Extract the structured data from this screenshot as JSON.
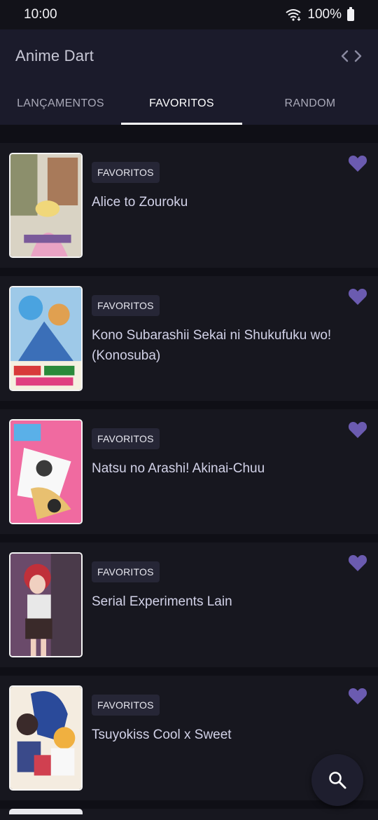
{
  "status": {
    "time": "10:00",
    "battery": "100%"
  },
  "app": {
    "title": "Anime Dart",
    "icon": "code-icon"
  },
  "tabs": [
    {
      "label": "LANÇAMENTOS",
      "active": false
    },
    {
      "label": "FAVORITOS",
      "active": true
    },
    {
      "label": "RANDOM",
      "active": false
    }
  ],
  "items": [
    {
      "badge": "FAVORITOS",
      "title": "Alice to Zouroku",
      "favorite": true
    },
    {
      "badge": "FAVORITOS",
      "title": "Kono Subarashii Sekai ni Shukufuku wo! (Konosuba)",
      "favorite": true
    },
    {
      "badge": "FAVORITOS",
      "title": "Natsu no Arashi! Akinai-Chuu",
      "favorite": true
    },
    {
      "badge": "FAVORITOS",
      "title": "Serial Experiments Lain",
      "favorite": true
    },
    {
      "badge": "FAVORITOS",
      "title": "Tsuyokiss Cool x Sweet",
      "favorite": true
    }
  ],
  "fab": {
    "icon": "search-icon"
  },
  "colors": {
    "accent": "#6b5bb0",
    "background": "#0f0f16",
    "card": "#17171f",
    "appbar": "#1b1b2b"
  }
}
